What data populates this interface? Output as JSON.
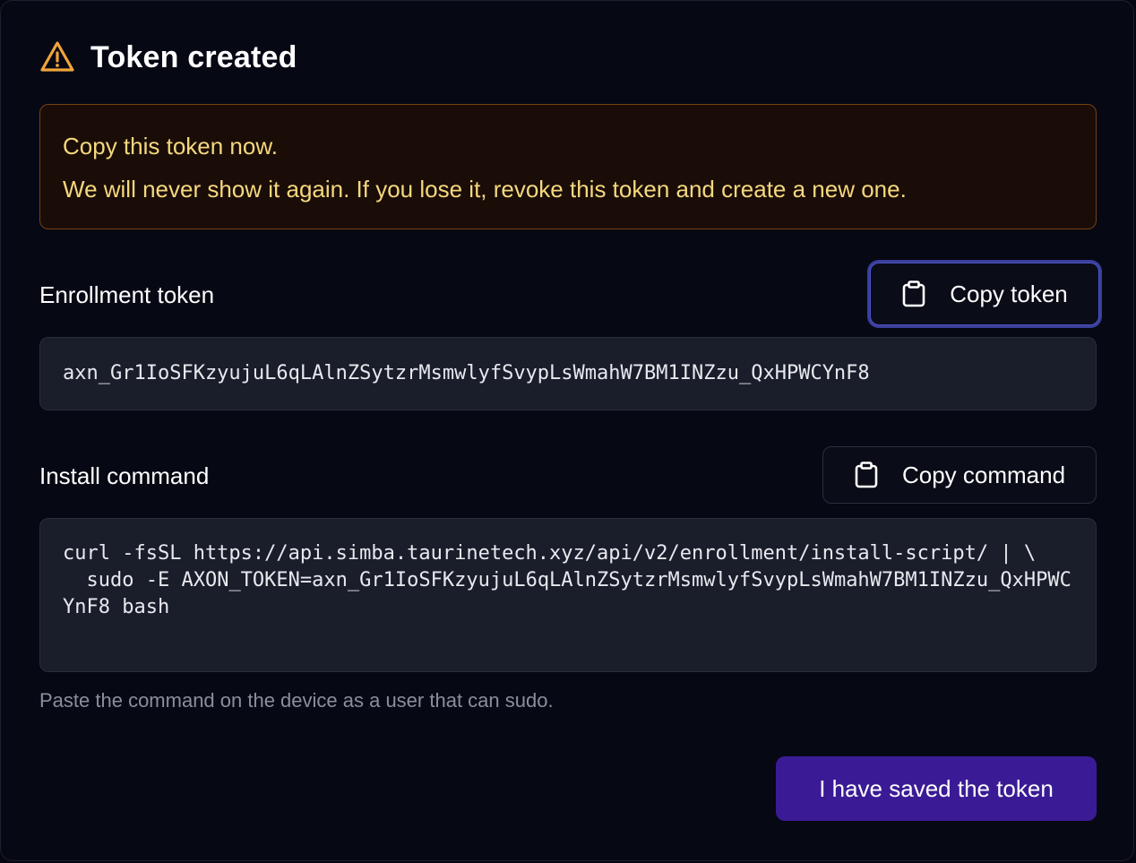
{
  "dialog": {
    "title": "Token created",
    "title_icon": "warning-triangle-icon"
  },
  "alert": {
    "headline": "Copy this token now.",
    "message": "We will never show it again. If you lose it, revoke this token and create a new one."
  },
  "token_section": {
    "label": "Enrollment token",
    "copy_button_label": "Copy token",
    "copy_icon": "clipboard-icon",
    "value": "axn_Gr1IoSFKzyujuL6qLAlnZSytzrMsmwlyfSvypLsWmahW7BM1INZzu_QxHPWCYnF8"
  },
  "command_section": {
    "label": "Install command",
    "copy_button_label": "Copy command",
    "copy_icon": "clipboard-icon",
    "value": "curl -fsSL https://api.simba.taurinetech.xyz/api/v2/enrollment/install-script/ | \\\n  sudo -E AXON_TOKEN=axn_Gr1IoSFKzyujuL6qLAlnZSytzrMsmwlyfSvypLsWmahW7BM1INZzu_QxHPWCYnF8 bash",
    "hint": "Paste the command on the device as a user that can sudo."
  },
  "footer": {
    "confirm_label": "I have saved the token"
  },
  "colors": {
    "background": "#060814",
    "warning": "#f0a43a",
    "alert_text": "#f5d87e",
    "primary": "#3a1b95",
    "focus_ring": "#3a3f9a"
  }
}
